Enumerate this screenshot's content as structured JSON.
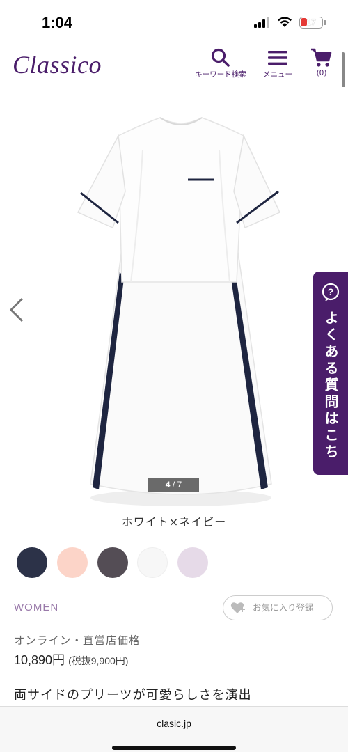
{
  "status": {
    "time": "1:04",
    "battery": "17",
    "battery_color": "#e53935"
  },
  "header": {
    "logo": "Classico",
    "search_label": "キーワード検索",
    "menu_label": "メニュー",
    "cart_label": "(0)",
    "brand_color": "#4a1d6a"
  },
  "gallery": {
    "current": "4",
    "total": "7",
    "separator": "/"
  },
  "faq": {
    "label": "よくある質問はこちら"
  },
  "product": {
    "color_name": "ホワイト×ネイビー",
    "swatches": [
      {
        "name": "navy",
        "color": "#2c3248"
      },
      {
        "name": "pink",
        "color": "#fcd4c8"
      },
      {
        "name": "charcoal",
        "color": "#544d55"
      },
      {
        "name": "white",
        "color": "#f7f7f7"
      },
      {
        "name": "lavender",
        "color": "#e6dae8"
      }
    ],
    "category": "WOMEN",
    "favorite_label": "お気に入り登録",
    "price_label": "オンライン・直営店価格",
    "price": "10,890円",
    "price_tax": "(税抜9,900円)",
    "headline": "両サイドのプリーツが可愛らしさを演出"
  },
  "browser": {
    "url": "clasic.jp"
  }
}
